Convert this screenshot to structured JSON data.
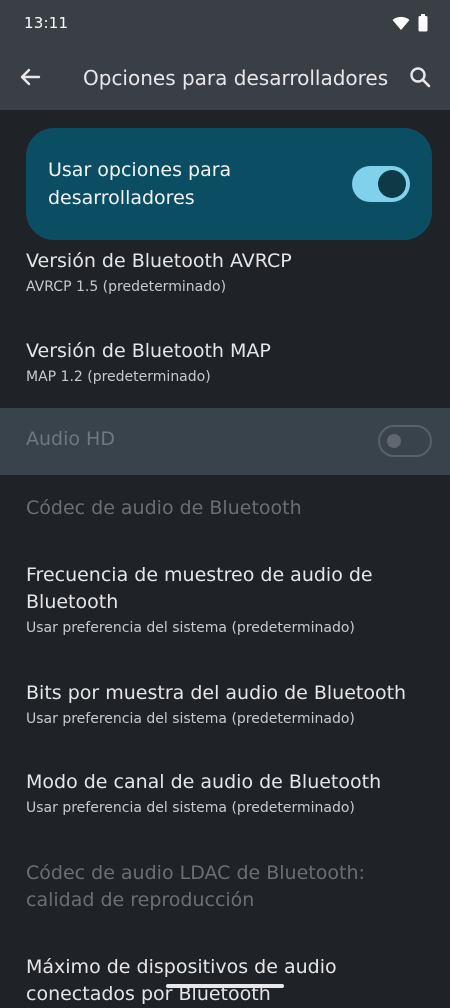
{
  "status": {
    "time": "13:11"
  },
  "header": {
    "title": "Opciones para desarrolladores"
  },
  "master": {
    "label": "Usar opciones para desarrolladores",
    "enabled": true
  },
  "prefs": [
    {
      "title": "Versión de Bluetooth AVRCP",
      "summary": "AVRCP 1.5 (predeterminado)"
    },
    {
      "title": "Versión de Bluetooth MAP",
      "summary": "MAP 1.2 (predeterminado)"
    },
    {
      "title": "Audio HD",
      "toggle": false
    },
    {
      "title": "Códec de audio de Bluetooth"
    },
    {
      "title": "Frecuencia de muestreo de audio de Bluetooth",
      "summary": "Usar preferencia del sistema (predeterminado)"
    },
    {
      "title": "Bits por muestra del audio de Bluetooth",
      "summary": "Usar preferencia del sistema (predeterminado)"
    },
    {
      "title": "Modo de canal de audio de Bluetooth",
      "summary": "Usar preferencia del sistema (predeterminado)"
    },
    {
      "title": "Códec de audio LDAC de Bluetooth: calidad de reproducción"
    },
    {
      "title": "Máximo de dispositivos de audio conectados por Bluetooth"
    }
  ],
  "icons": {
    "wifi": "wifi-icon",
    "battery": "battery-icon",
    "back": "back-arrow-icon",
    "search": "search-icon"
  }
}
